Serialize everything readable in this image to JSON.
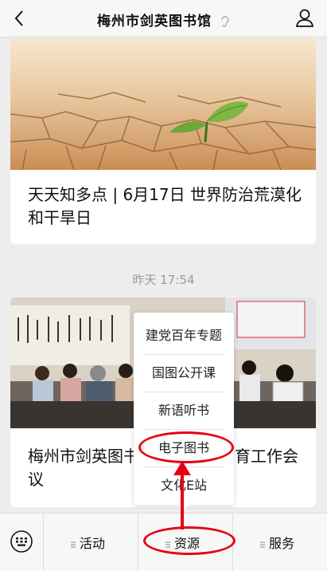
{
  "header": {
    "title": "梅州市剑英图书馆",
    "back_icon": "back-chevron-icon",
    "user_icon": "user-icon"
  },
  "articles": [
    {
      "title": "天天知多点 | 6月17日 世界防治荒漠化和干旱日"
    },
    {
      "title": "梅州市剑英图书馆党史学习教育工作会议"
    }
  ],
  "timestamp": "昨天 17:54",
  "popup_menu": {
    "items": [
      "建党百年专题",
      "国图公开课",
      "新语听书",
      "电子图书",
      "文化E站"
    ]
  },
  "bottom_menu": {
    "tabs": [
      "活动",
      "资源",
      "服务"
    ]
  },
  "colors": {
    "annotation": "#e60012",
    "background": "#ededed"
  }
}
